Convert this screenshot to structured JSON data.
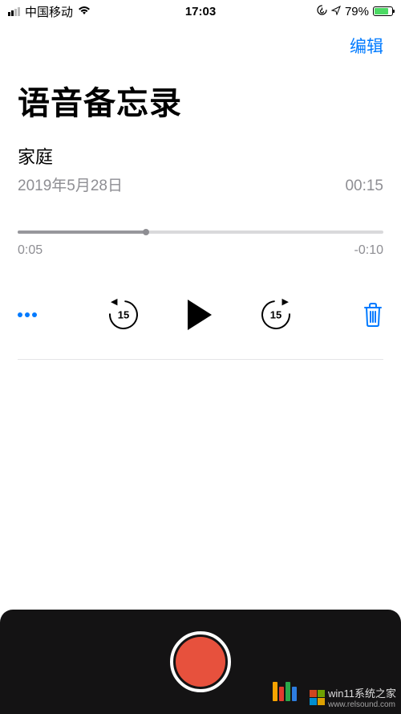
{
  "status": {
    "carrier": "中国移动",
    "time": "17:03",
    "battery_pct": "79%"
  },
  "nav": {
    "edit": "编辑"
  },
  "title": "语音备忘录",
  "recording": {
    "name": "家庭",
    "date": "2019年5月28日",
    "duration": "00:15",
    "elapsed": "0:05",
    "remaining": "-0:10",
    "skip_seconds": "15"
  },
  "watermark": {
    "site1": "win11系统之家",
    "site2": "www.relsound.com"
  }
}
